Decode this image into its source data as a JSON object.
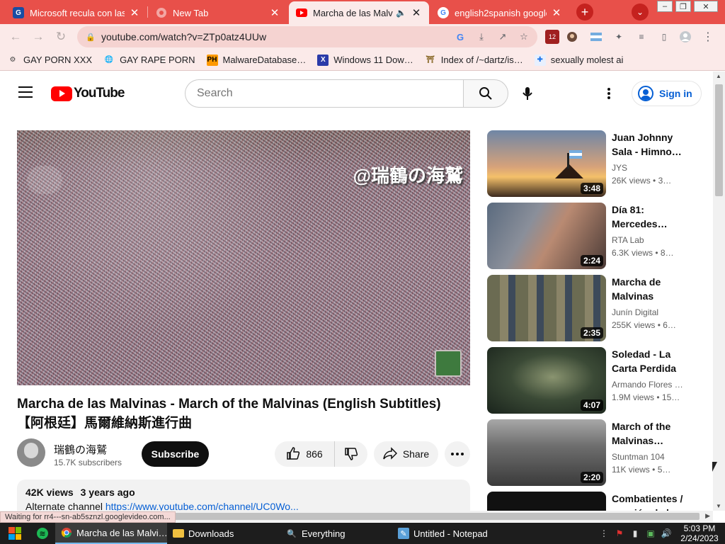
{
  "browser": {
    "tabs": [
      {
        "title": "Microsoft recula con las",
        "icon": "G"
      },
      {
        "title": "New Tab",
        "icon": "chrome"
      },
      {
        "title": "Marcha de las Malvi",
        "icon": "youtube"
      },
      {
        "title": "english2spanish google",
        "icon": "G"
      }
    ],
    "new_tab_symbol": "+",
    "url": "youtube.com/watch?v=ZTp0atz4UUw",
    "extension_badge": "12",
    "bookmarks": [
      {
        "label": "GAY PORN XXX",
        "icon": "gear"
      },
      {
        "label": "GAY RAPE PORN",
        "icon": "globe"
      },
      {
        "label": "MalwareDatabase…",
        "icon": "PH"
      },
      {
        "label": "Windows 11 Dow…",
        "icon": "X"
      },
      {
        "label": "Index of /~dartz/is…",
        "icon": "shrine"
      },
      {
        "label": "sexually molest ai",
        "icon": "puzzle"
      }
    ]
  },
  "youtube": {
    "logo_text": "YouTube",
    "search_placeholder": "Search",
    "signin_label": "Sign in",
    "video": {
      "watermark": "@瑞鶴の海鷲",
      "title": "Marcha de las Malvinas - March of the Malvinas (English Subtitles) 【阿根廷】馬爾維納斯進行曲",
      "channel": "瑞鶴の海鷲",
      "subscribers": "15.7K subscribers",
      "subscribe_label": "Subscribe",
      "likes": "866",
      "share_label": "Share",
      "views": "42K views",
      "age": "3 years ago",
      "desc_prefix": "Alternate channel",
      "desc_link": "https://www.youtube.com/channel/UC0Wo..."
    },
    "recommendations": [
      {
        "title": "Juan Johnny Sala - Himno…",
        "channel": "JYS",
        "views": "26K views",
        "age": "• 3…",
        "duration": "3:48"
      },
      {
        "title": "Día 81: Mercedes…",
        "channel": "RTA Lab",
        "views": "6.3K views",
        "age": "• 8…",
        "duration": "2:24"
      },
      {
        "title": "Marcha de Malvinas",
        "channel": "Junín Digital",
        "views": "255K views",
        "age": "• 6…",
        "duration": "2:35"
      },
      {
        "title": "Soledad - La Carta Perdida",
        "channel": "Armando Flores …",
        "views": "1.9M views",
        "age": "• 15…",
        "duration": "4:07"
      },
      {
        "title": "March of the Malvinas…",
        "channel": "Stuntman 104",
        "views": "11K views",
        "age": "• 5…",
        "duration": "2:20"
      },
      {
        "title": "Combatientes / canción de la…",
        "channel": "",
        "views": "",
        "age": "",
        "duration": ""
      }
    ]
  },
  "status_text": "Waiting for rr4---sn-ab5sznzl.googlevideo.com...",
  "taskbar": {
    "items": [
      {
        "label": "Marcha de las Malvi…",
        "icon": "chrome"
      },
      {
        "label": "Downloads",
        "icon": "folder"
      },
      {
        "label": "Everything",
        "icon": "search"
      },
      {
        "label": "Untitled - Notepad",
        "icon": "notepad"
      }
    ],
    "time": "5:03 PM",
    "date": "2/24/2023"
  }
}
